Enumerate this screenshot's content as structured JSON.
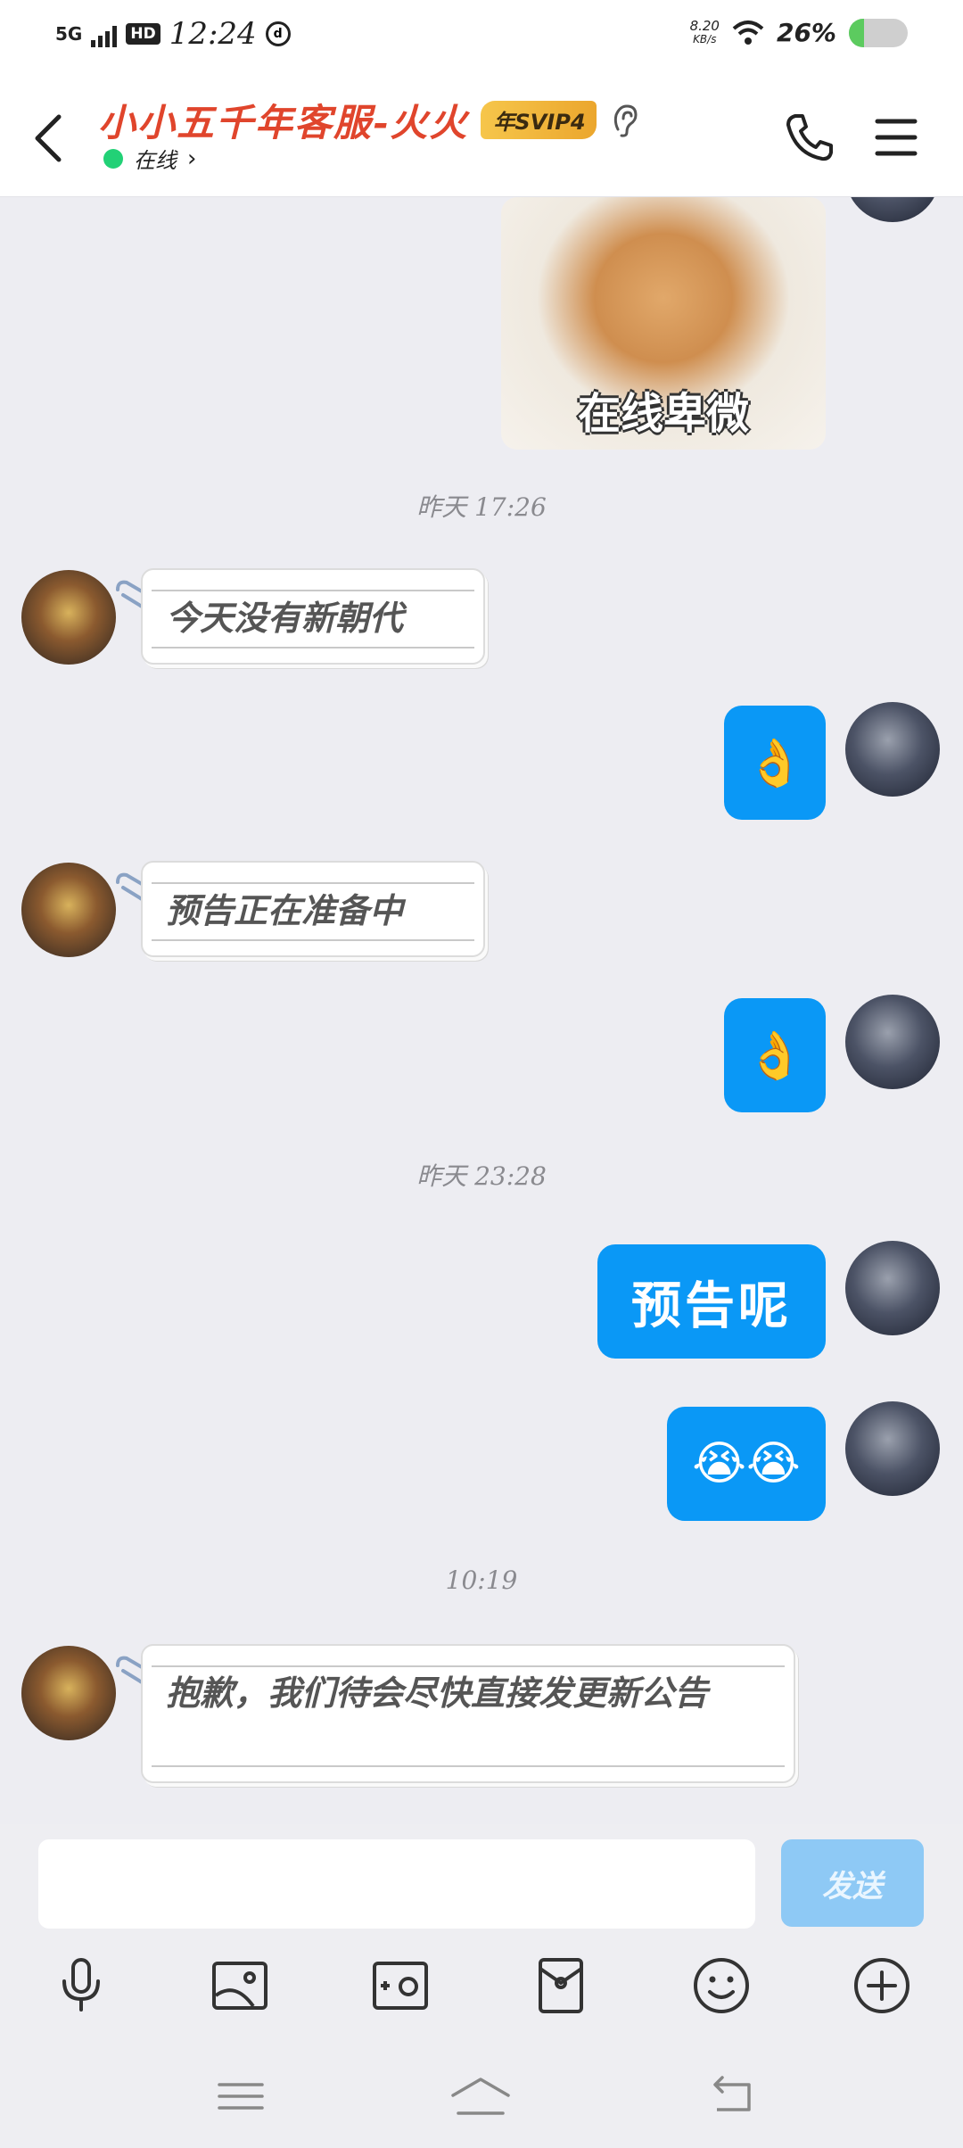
{
  "status_bar": {
    "network": "5G",
    "hd": "HD",
    "time": "12:24",
    "notification_glyph": "ⓓ",
    "speed_value": "8.20",
    "speed_unit": "KB/s",
    "battery": "26%",
    "battery_level": 0.26
  },
  "header": {
    "title": "小小五千年客服-火火",
    "vip_badge": "年SVIP4",
    "status": "在线",
    "status_chevron": "›"
  },
  "messages": {
    "sticker_caption": "在线卑微",
    "time_1": "昨天 17:26",
    "cs_msg_1": "今天没有新朝代",
    "me_msg_1": "👌",
    "cs_msg_2": "预告正在准备中",
    "me_msg_2": "👌",
    "time_2": "昨天 23:28",
    "me_msg_3": "预告呢",
    "me_msg_4": "😭😭",
    "time_3": "10:19",
    "cs_msg_3": "抱歉，我们待会尽快直接发更新公告"
  },
  "input": {
    "placeholder": "",
    "send_label": "发送"
  },
  "colors": {
    "accent": "#0a98f6",
    "title": "#e0452c",
    "online": "#22d176",
    "send_disabled": "#8ec9f5"
  },
  "icons": {
    "toolbar": [
      "microphone-icon",
      "image-icon",
      "camera-icon",
      "red-packet-icon",
      "emoji-icon",
      "plus-icon"
    ],
    "nav": [
      "menu-icon",
      "home-icon",
      "back-icon"
    ]
  }
}
